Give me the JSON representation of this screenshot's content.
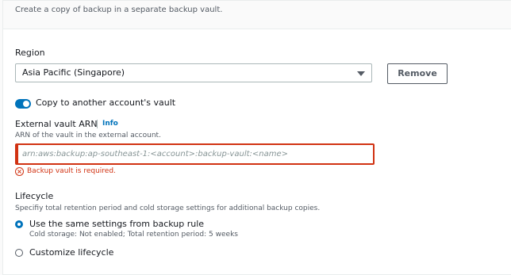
{
  "section": {
    "description": "Create a copy of backup in a separate backup vault."
  },
  "region": {
    "label": "Region",
    "selected": "Asia Pacific (Singapore)",
    "remove_button": "Remove"
  },
  "copy_toggle": {
    "label": "Copy to another account's vault",
    "enabled": true
  },
  "external_vault": {
    "label": "External vault ARN",
    "info_link": "Info",
    "description": "ARN of the vault in the external account.",
    "placeholder": "arn:aws:backup:ap-southeast-1:<account>:backup-vault:<name>",
    "value": "",
    "error": "Backup vault is required."
  },
  "lifecycle": {
    "label": "Lifecycle",
    "description": "Specifiy total retention period and cold storage settings for additional backup copies.",
    "options": [
      {
        "label": "Use the same settings from backup rule",
        "detail": "Cold storage: Not enabled; Total retention period: 5 weeks",
        "selected": true
      },
      {
        "label": "Customize lifecycle",
        "detail": "",
        "selected": false
      }
    ]
  },
  "colors": {
    "accent": "#0073bb",
    "error": "#d13212",
    "text": "#16191f",
    "muted": "#545b64"
  }
}
